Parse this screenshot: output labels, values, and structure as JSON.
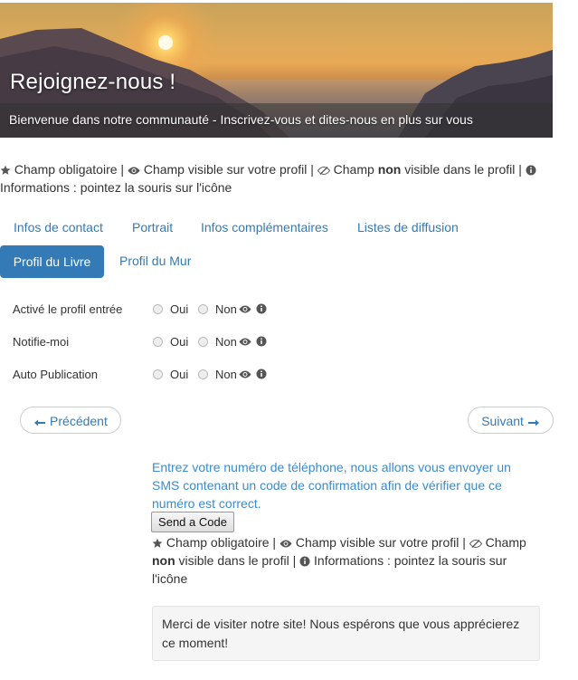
{
  "banner": {
    "title": "Rejoignez-nous !",
    "subtitle": "Bienvenue dans notre communauté - Inscrivez-vous et dites-nous en plus sur vous"
  },
  "legend": {
    "required": "Champ obligatoire",
    "sep": "|",
    "visible": "Champ visible sur votre profil",
    "champ": "Champ",
    "non": "non",
    "not_visible_rest": "visible dans le profil",
    "info": "Informations : pointez la souris sur l'icône"
  },
  "tabs": [
    {
      "label": "Infos de contact"
    },
    {
      "label": "Portrait"
    },
    {
      "label": "Infos complémentaires"
    },
    {
      "label": "Listes de diffusion"
    },
    {
      "label": "Profil du Livre"
    },
    {
      "label": "Profil du Mur"
    }
  ],
  "active_tab": "Profil du Livre",
  "fields": [
    {
      "label": "Activé le profil entrée",
      "yes": "Oui",
      "no": "Non"
    },
    {
      "label": "Notifie-moi",
      "yes": "Oui",
      "no": "Non"
    },
    {
      "label": "Auto Publication",
      "yes": "Oui",
      "no": "Non"
    }
  ],
  "nav": {
    "prev": "Précédent",
    "next": "Suivant"
  },
  "sms": {
    "text": "Entrez votre numéro de téléphone, nous allons vous envoyer un SMS contenant un code de confirmation afin de vérifier que ce numéro est correct.",
    "button": "Send a Code"
  },
  "thanks": "Merci de visiter notre site! Nous espérons que vous apprécierez ce moment!",
  "colors": {
    "link": "#337ab7",
    "active_tab_bg": "#337ab7",
    "sms_text": "#3b8bd0"
  },
  "icons": [
    "star-icon",
    "eye-icon",
    "eye-slash-icon",
    "info-circle-icon",
    "arrow-left-icon",
    "arrow-right-icon"
  ]
}
